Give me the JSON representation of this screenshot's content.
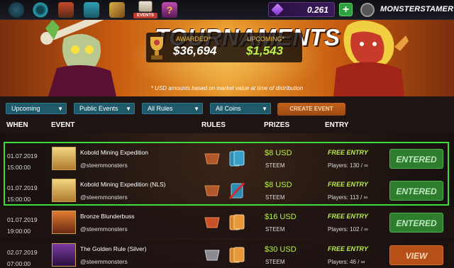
{
  "nav": {
    "events_label": "EVENTS",
    "balance": "0.261",
    "username": "MONSTERSTAMER"
  },
  "banner": {
    "title": "TOURNAMENTS",
    "awarded_label": "AWARDED*",
    "awarded_value": "$36,694",
    "upcoming_label": "UPCOMING*",
    "upcoming_value": "$1,543",
    "disclaimer": "* USD amounts based on market value at time of distribution"
  },
  "filters": {
    "status": "Upcoming",
    "visibility": "Public Events",
    "rules": "All Rules",
    "coins": "All Coins",
    "create_label": "CREATE EVENT"
  },
  "table": {
    "headers": [
      "WHEN",
      "EVENT",
      "RULES",
      "PRIZES",
      "ENTRY"
    ],
    "rows": [
      {
        "date": "01.07.2019",
        "time": "15:00:00",
        "name": "Kobold Mining Expedition",
        "org": "@steemmonsters",
        "prize": "$8 USD",
        "coin": "STEEM",
        "entry": "FREE ENTRY",
        "players": "Players: 130 / ∞",
        "button": "ENTERED"
      },
      {
        "date": "01.07.2019",
        "time": "15:00:00",
        "name": "Kobold Mining Expedition (NLS)",
        "org": "@steemmonsters",
        "prize": "$8 USD",
        "coin": "STEEM",
        "entry": "FREE ENTRY",
        "players": "Players: 113 / ∞",
        "button": "ENTERED"
      },
      {
        "date": "01.07.2019",
        "time": "19:00:00",
        "name": "Bronze Blunderbuss",
        "org": "@steemmonsters",
        "prize": "$16 USD",
        "coin": "STEEM",
        "entry": "FREE ENTRY",
        "players": "Players: 102 / ∞",
        "button": "ENTERED"
      },
      {
        "date": "02.07.2019",
        "time": "07:00:00",
        "name": "The Golden Rule (Silver)",
        "org": "@steemmonsters",
        "prize": "$30 USD",
        "coin": "STEEM",
        "entry": "FREE ENTRY",
        "players": "Players: 46 / ∞",
        "button": "VIEW"
      }
    ]
  },
  "colors": {
    "accent_green": "#b9f04a",
    "entered_button": "#2e7d2e",
    "view_button": "#b65018",
    "filter_select": "#1f5a6a",
    "highlight_box": "#3cdc3c"
  },
  "icons": [
    "swirl-icon",
    "monster-icon",
    "cards-icon",
    "sword-icon",
    "events-icon",
    "question-icon",
    "dec-gem-icon",
    "avatar-icon",
    "trophy-icon"
  ]
}
